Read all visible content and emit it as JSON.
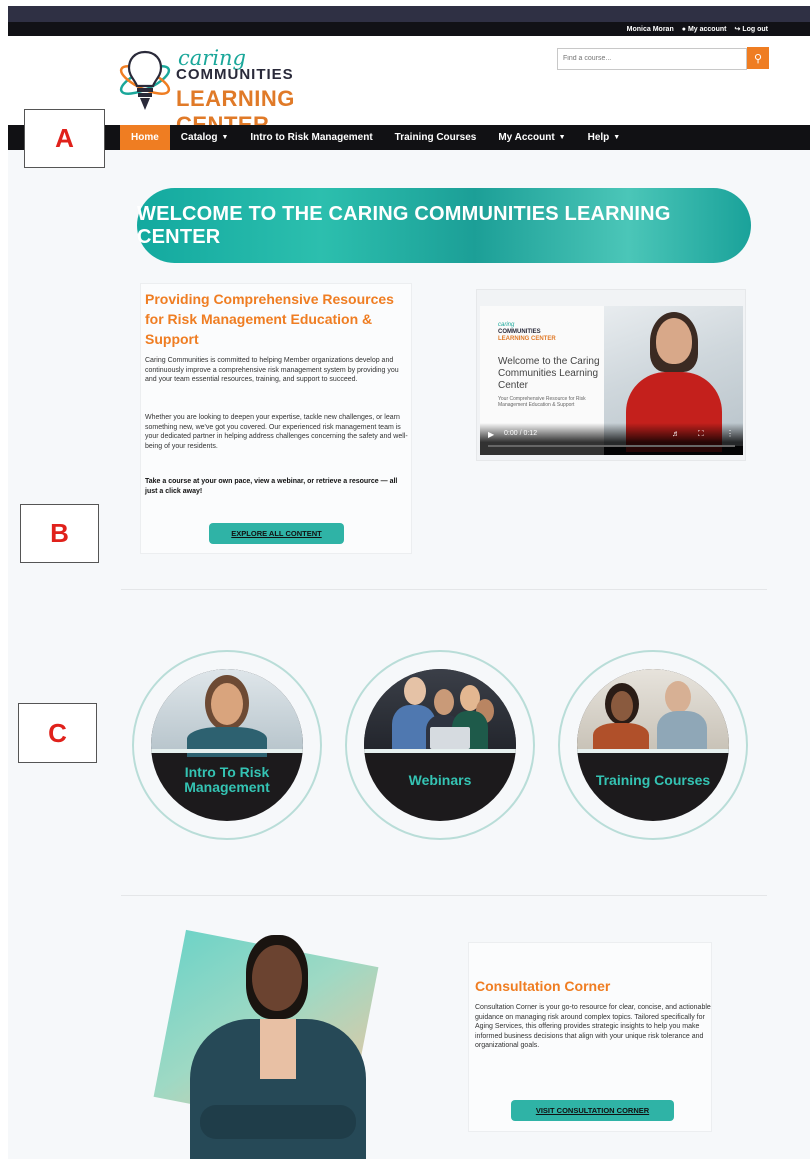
{
  "utility_bar": {
    "user_name": "Monica Moran",
    "my_account": "My account",
    "logout": "Log out"
  },
  "logo": {
    "line1": "caring",
    "line2": "COMMUNITIES",
    "line3": "LEARNING CENTER"
  },
  "search": {
    "placeholder": "Find a course..."
  },
  "nav": {
    "items": [
      {
        "label": "Home",
        "active": true,
        "dropdown": false
      },
      {
        "label": "Catalog",
        "active": false,
        "dropdown": true
      },
      {
        "label": "Intro to Risk Management",
        "active": false,
        "dropdown": false
      },
      {
        "label": "Training Courses",
        "active": false,
        "dropdown": false
      },
      {
        "label": "My Account",
        "active": false,
        "dropdown": true
      },
      {
        "label": "Help",
        "active": false,
        "dropdown": true
      }
    ]
  },
  "banner": {
    "text": "WELCOME TO THE CARING COMMUNITIES LEARNING CENTER"
  },
  "info": {
    "title": "Providing Comprehensive Resources for Risk Management Education & Support",
    "paragraph1": "Caring Communities is committed to helping Member organizations develop and continuously improve a comprehensive risk management system by providing you and your team essential resources, training, and support to succeed.",
    "paragraph2": "Whether you are looking to deepen your expertise, tackle new challenges, or learn something new, we've got you covered. Our experienced risk management team is your dedicated partner in helping address challenges concerning the safety and well-being of your residents.",
    "paragraph3": "Take a course at your own pace, view a webinar, or retrieve a resource — all just a click away!",
    "button": "EXPLORE ALL CONTENT"
  },
  "video": {
    "logo_line1": "caring",
    "logo_line2": "COMMUNITIES",
    "logo_line3": "LEARNING CENTER",
    "title": "Welcome to the Caring Communities Learning Center",
    "subtitle": "Your Comprehensive Resource for Risk Management Education & Support",
    "time": "0:00 / 0:12",
    "progress": 0.0
  },
  "circles": [
    {
      "label": "Intro To Risk Management"
    },
    {
      "label": "Webinars"
    },
    {
      "label": "Training Courses"
    }
  ],
  "consultation": {
    "title": "Consultation Corner",
    "text": "Consultation Corner is your go-to resource for clear, concise, and actionable guidance on managing risk around complex topics. Tailored specifically for Aging Services, this offering provides strategic insights to help you make informed business decisions that align with your unique risk tolerance and organizational goals.",
    "button": "VISIT CONSULTATION CORNER"
  },
  "markers": [
    "A",
    "B",
    "C"
  ],
  "colors": {
    "accent_orange": "#ef7d22",
    "teal": "#2fb3a6",
    "nav_dark": "#111114",
    "marker_red": "#e0211b"
  }
}
